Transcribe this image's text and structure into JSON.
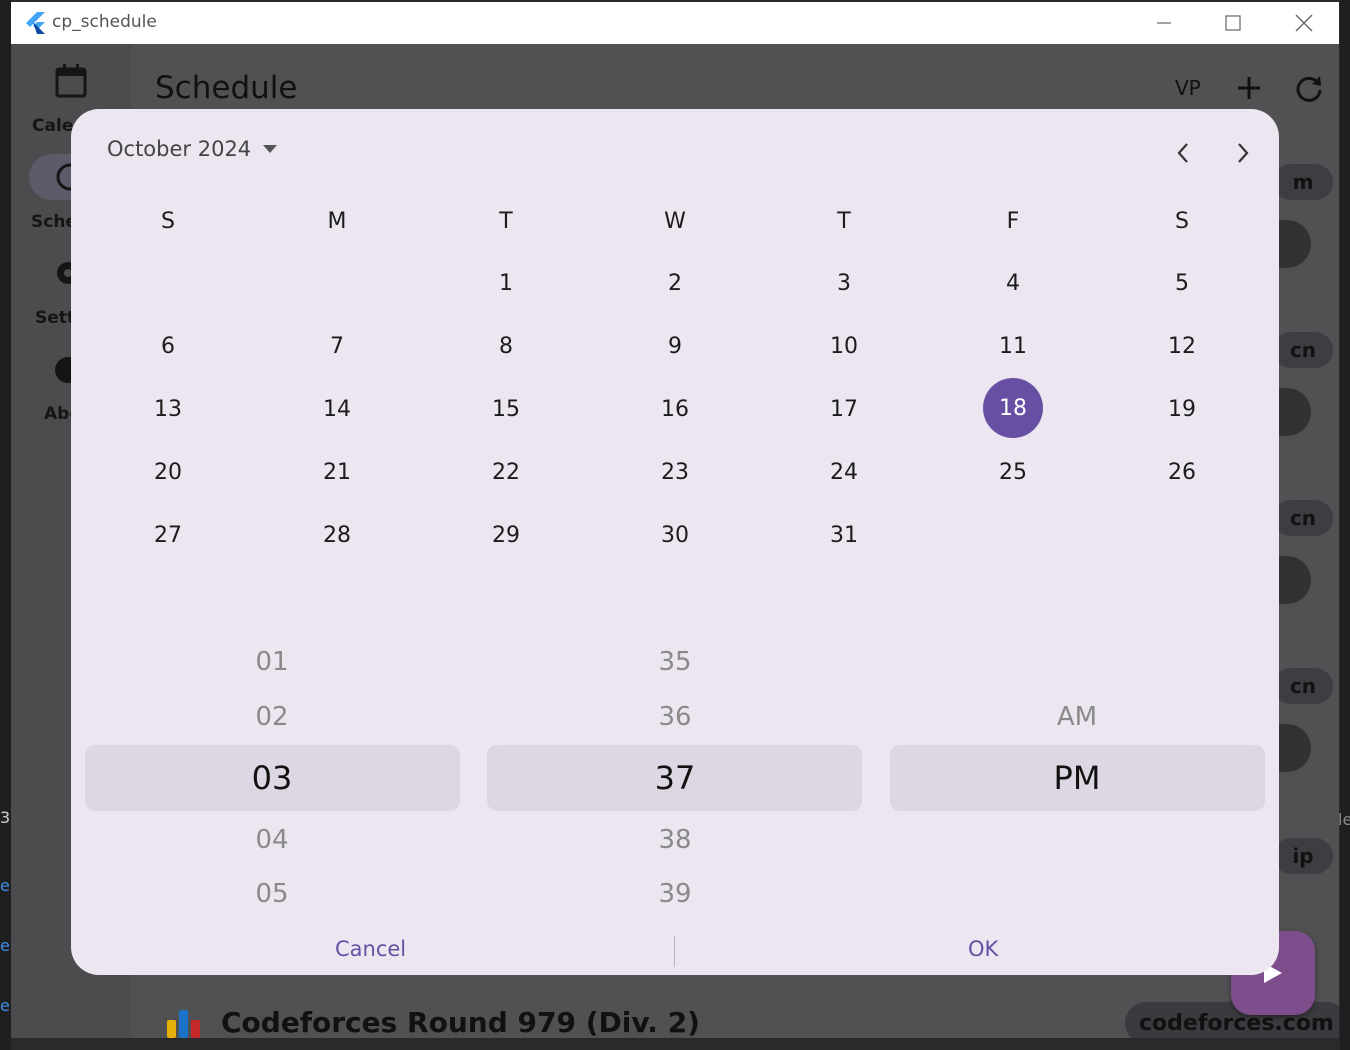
{
  "window": {
    "title": "cp_schedule"
  },
  "nav_rail": {
    "items": [
      {
        "label": "Cale",
        "icon": "calendar-icon"
      },
      {
        "label": "Sche",
        "icon": "clock-icon"
      },
      {
        "label": "Sett",
        "icon": "gear-icon"
      },
      {
        "label": "Abo",
        "icon": "info-icon"
      }
    ]
  },
  "app_bar": {
    "title": "Schedule",
    "vp_label": "VP"
  },
  "background": {
    "card_chips": [
      "m",
      "cn",
      "cn",
      "cn",
      "ip"
    ],
    "bottom_item": {
      "title": "Codeforces Round 979 (Div. 2)",
      "site": "codeforces.com"
    }
  },
  "date_picker": {
    "month_label": "October 2024",
    "weekdays": [
      "S",
      "M",
      "T",
      "W",
      "T",
      "F",
      "S"
    ],
    "weeks": [
      [
        "",
        "",
        "1",
        "2",
        "3",
        "4",
        "5"
      ],
      [
        "6",
        "7",
        "8",
        "9",
        "10",
        "11",
        "12"
      ],
      [
        "13",
        "14",
        "15",
        "16",
        "17",
        "18",
        "19"
      ],
      [
        "20",
        "21",
        "22",
        "23",
        "24",
        "25",
        "26"
      ],
      [
        "27",
        "28",
        "29",
        "30",
        "31",
        "",
        ""
      ]
    ],
    "selected_day": "18"
  },
  "time_picker": {
    "hours": [
      "01",
      "02",
      "03",
      "04",
      "05"
    ],
    "minutes": [
      "35",
      "36",
      "37",
      "38",
      "39"
    ],
    "period": [
      "AM",
      "PM"
    ],
    "selected": {
      "hour": "03",
      "minute": "37",
      "period": "PM"
    }
  },
  "actions": {
    "cancel": "Cancel",
    "ok": "OK"
  },
  "colors": {
    "accent": "#6750a4",
    "dialog_bg": "#ece6f1",
    "fab": "#7d4e8b"
  }
}
